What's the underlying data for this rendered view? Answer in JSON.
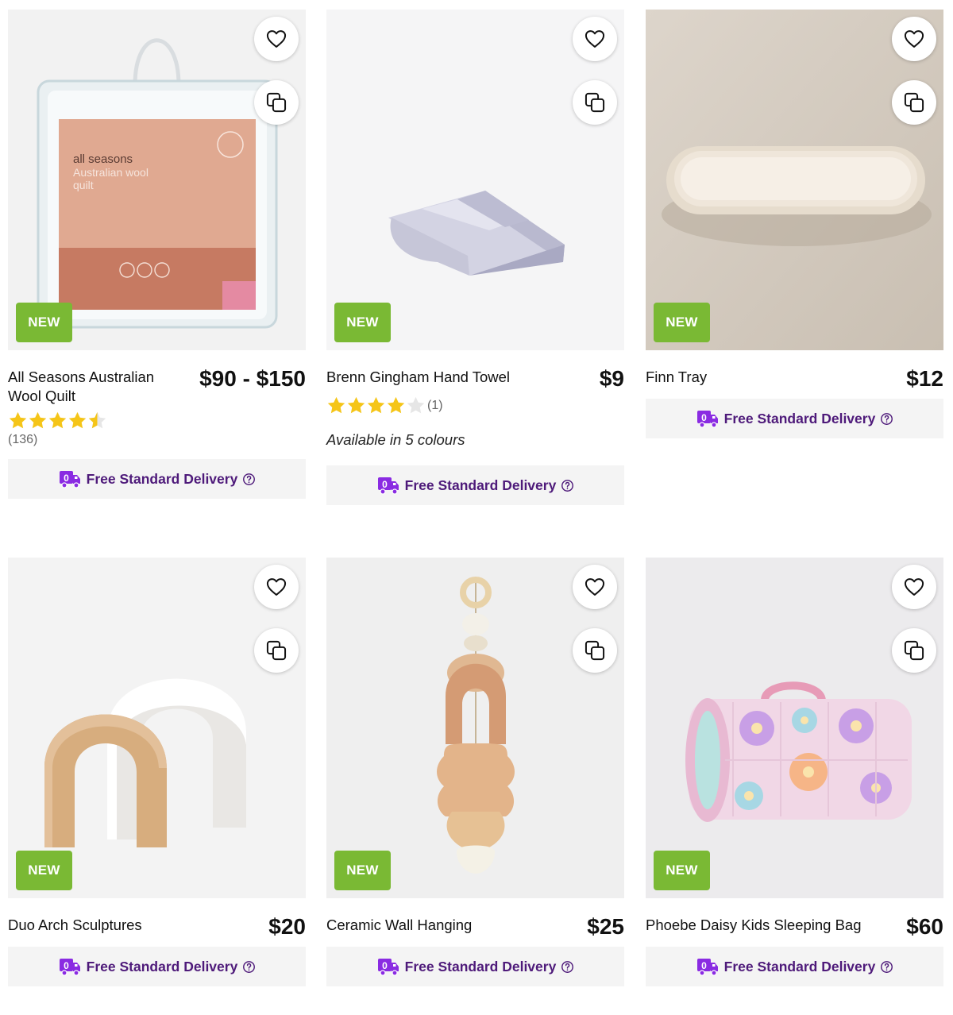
{
  "colors": {
    "new_badge": "#7ab934",
    "delivery_text": "#4e1a7a",
    "star": "#f5c518"
  },
  "products": [
    {
      "name": "All Seasons Australian Wool Quilt",
      "price": "$90 - $150",
      "badge": "NEW",
      "rating": 4.5,
      "review_count": "(136)",
      "delivery": "Free Standard Delivery",
      "image_text": {
        "title": "all seasons",
        "sub1": "Australian wool",
        "sub2": "quilt"
      }
    },
    {
      "name": "Brenn Gingham Hand Towel",
      "price": "$9",
      "badge": "NEW",
      "rating": 4,
      "review_count": "(1)",
      "colours": "Available in 5 colours",
      "delivery": "Free Standard Delivery"
    },
    {
      "name": "Finn Tray",
      "price": "$12",
      "badge": "NEW",
      "delivery": "Free Standard Delivery"
    },
    {
      "name": "Duo Arch Sculptures",
      "price": "$20",
      "badge": "NEW",
      "delivery": "Free Standard Delivery"
    },
    {
      "name": "Ceramic Wall Hanging",
      "price": "$25",
      "badge": "NEW",
      "delivery": "Free Standard Delivery"
    },
    {
      "name": "Phoebe Daisy Kids Sleeping Bag",
      "price": "$60",
      "badge": "NEW",
      "delivery": "Free Standard Delivery"
    }
  ],
  "icons": {
    "wishlist": "heart-icon",
    "compare": "compare-icon",
    "delivery": "delivery-truck-icon",
    "help": "help-circle-icon"
  }
}
